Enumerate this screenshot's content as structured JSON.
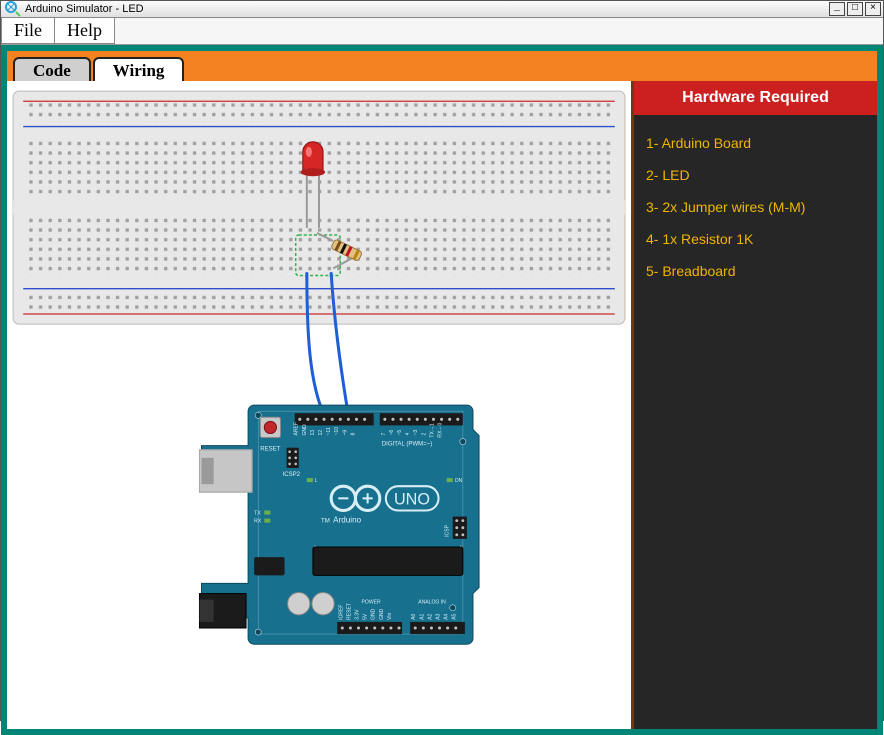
{
  "window": {
    "title": "Arduino Simulator - LED"
  },
  "menu": {
    "file": "File",
    "help": "Help"
  },
  "tabs": {
    "code": "Code",
    "wiring": "Wiring",
    "active": "wiring"
  },
  "side": {
    "header": "Hardware Required",
    "items": [
      "1- Arduino Board",
      "2- LED",
      "3- 2x Jumper wires (M-M)",
      "4- 1x Resistor 1K",
      "5- Breadboard"
    ]
  },
  "arduino": {
    "brand_line": "Arduino",
    "model": "UNO",
    "reset": "RESET",
    "icsp2": "ICSP2",
    "icsp": "ICSP",
    "on_label": "ON",
    "l_label": "L",
    "tx": "TX",
    "rx": "RX",
    "digital_label": "DIGITAL (PWM=~)",
    "analog_label": "ANALOG IN",
    "power_label": "POWER",
    "aref": "AREF",
    "gnd_top": "GND",
    "digital_pins": [
      "13",
      "12",
      "~11",
      "~10",
      "~9",
      "8",
      "7",
      "~6",
      "~5",
      "4",
      "~3",
      "2",
      "TX→1",
      "RX←0"
    ],
    "power_pins": [
      "IOREF",
      "RESET",
      "3.3V",
      "5V",
      "GND",
      "GND",
      "Vin"
    ],
    "analog_pins": [
      "A0",
      "A1",
      "A2",
      "A3",
      "A4",
      "A5"
    ]
  },
  "colors": {
    "accent_orange": "#f58220",
    "teal": "#008577",
    "arduino_blue": "#17708e",
    "side_dark": "#262626",
    "side_red": "#cc1f1f",
    "side_yellow": "#f0b400"
  }
}
